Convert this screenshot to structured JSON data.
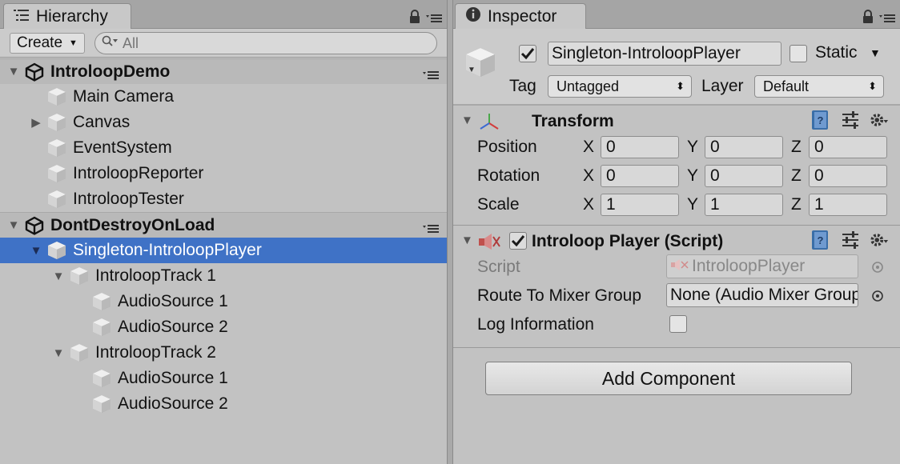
{
  "hierarchy": {
    "tab_label": "Hierarchy",
    "create_label": "Create",
    "search_placeholder": "All",
    "rows": [
      {
        "label": "IntroloopDemo",
        "kind": "scene",
        "indent": 0,
        "expand": "open"
      },
      {
        "label": "Main Camera",
        "kind": "object",
        "indent": 1,
        "expand": "none"
      },
      {
        "label": "Canvas",
        "kind": "object",
        "indent": 1,
        "expand": "closed"
      },
      {
        "label": "EventSystem",
        "kind": "object",
        "indent": 1,
        "expand": "none"
      },
      {
        "label": "IntroloopReporter",
        "kind": "object",
        "indent": 1,
        "expand": "none"
      },
      {
        "label": "IntroloopTester",
        "kind": "object",
        "indent": 1,
        "expand": "none"
      },
      {
        "label": "DontDestroyOnLoad",
        "kind": "scene",
        "indent": 0,
        "expand": "open"
      },
      {
        "label": "Singleton-IntroloopPlayer",
        "kind": "object",
        "indent": 1,
        "expand": "open",
        "selected": true
      },
      {
        "label": "IntroloopTrack 1",
        "kind": "object",
        "indent": 2,
        "expand": "open"
      },
      {
        "label": "AudioSource 1",
        "kind": "object",
        "indent": 3,
        "expand": "none"
      },
      {
        "label": "AudioSource 2",
        "kind": "object",
        "indent": 3,
        "expand": "none"
      },
      {
        "label": "IntroloopTrack 2",
        "kind": "object",
        "indent": 2,
        "expand": "open"
      },
      {
        "label": "AudioSource 1",
        "kind": "object",
        "indent": 3,
        "expand": "none"
      },
      {
        "label": "AudioSource 2",
        "kind": "object",
        "indent": 3,
        "expand": "none"
      }
    ]
  },
  "inspector": {
    "tab_label": "Inspector",
    "object_name": "Singleton-IntroloopPlayer",
    "active": true,
    "static_label": "Static",
    "static_checked": false,
    "tag_label": "Tag",
    "tag_value": "Untagged",
    "layer_label": "Layer",
    "layer_value": "Default",
    "transform": {
      "title": "Transform",
      "position_label": "Position",
      "rotation_label": "Rotation",
      "scale_label": "Scale",
      "x": "X",
      "y": "Y",
      "z": "Z",
      "position": [
        "0",
        "0",
        "0"
      ],
      "rotation": [
        "0",
        "0",
        "0"
      ],
      "scale": [
        "1",
        "1",
        "1"
      ]
    },
    "script_component": {
      "title": "Introloop Player (Script)",
      "enabled": true,
      "script_label": "Script",
      "script_value": "IntroloopPlayer",
      "mixer_label": "Route To Mixer Group",
      "mixer_value": "None (Audio Mixer Group)",
      "log_label": "Log Information",
      "log_checked": false
    },
    "add_component_label": "Add Component"
  },
  "colors": {
    "selection": "#3f72c6",
    "panel_bg": "#c2c2c2",
    "tab_bar": "#a5a5a5"
  }
}
